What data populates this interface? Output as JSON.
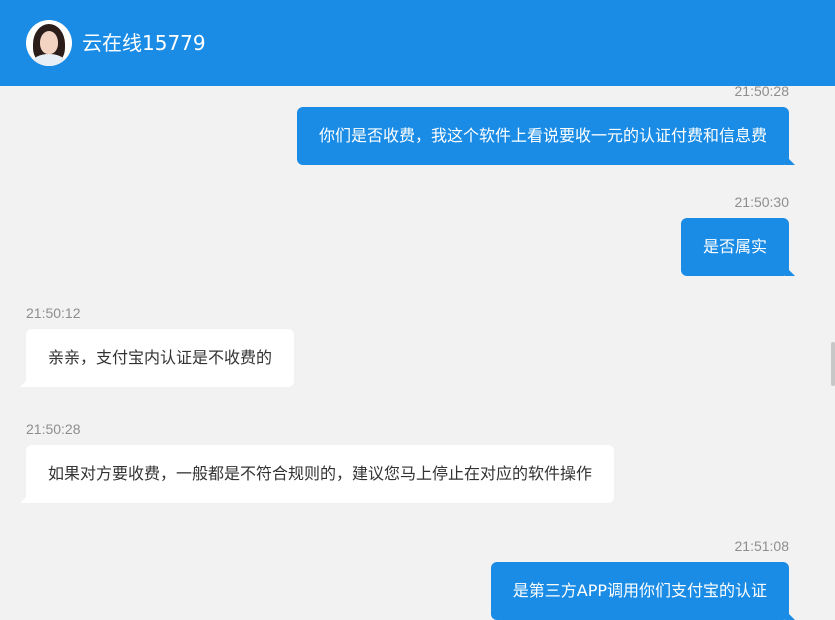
{
  "header": {
    "contact_name": "云在线15779",
    "avatar_icon": "user-avatar-photo"
  },
  "messages": [
    {
      "side": "right",
      "time": "21:50:28",
      "text": "你们是否收费，我这个软件上看说要收一元的认证付费和信息费"
    },
    {
      "side": "right",
      "time": "21:50:30",
      "text": "是否属实"
    },
    {
      "side": "left",
      "time": "21:50:12",
      "text": "亲亲，支付宝内认证是不收费的"
    },
    {
      "side": "left",
      "time": "21:50:28",
      "text": "如果对方要收费，一般都是不符合规则的，建议您马上停止在对应的软件操作"
    },
    {
      "side": "right",
      "time": "21:51:08",
      "text": "是第三方APP调用你们支付宝的认证"
    }
  ],
  "colors": {
    "header": "#1a8ce6",
    "sent_bubble": "#1a8ce6",
    "received_bubble": "#ffffff",
    "background": "#f2f2f2"
  }
}
